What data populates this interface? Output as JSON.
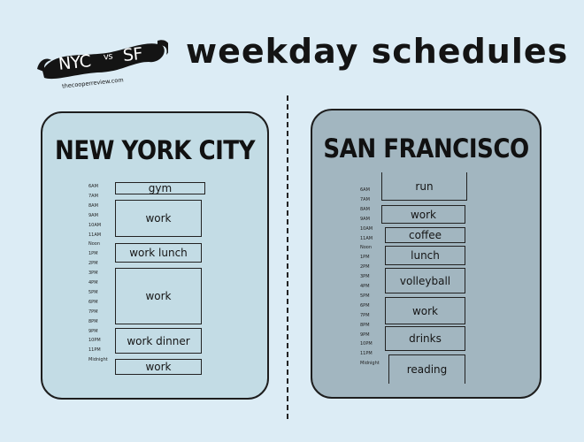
{
  "logo": {
    "nyc": "NYC",
    "vs": "vs",
    "sf": "SF",
    "url": "thecooperreview.com"
  },
  "title": "weekday schedules",
  "nyc": {
    "title": "NEW YORK CITY",
    "times": [
      "6AM",
      "7AM",
      "8AM",
      "9AM",
      "10AM",
      "11AM",
      "Noon",
      "1PM",
      "2PM",
      "3PM",
      "4PM",
      "5PM",
      "6PM",
      "7PM",
      "8PM",
      "9PM",
      "10PM",
      "11PM",
      "Midnight"
    ],
    "blocks": [
      {
        "label": "gym"
      },
      {
        "label": "work"
      },
      {
        "label": "work lunch"
      },
      {
        "label": "work"
      },
      {
        "label": "work dinner"
      },
      {
        "label": "work"
      }
    ]
  },
  "sf": {
    "title": "SAN FRANCISCO",
    "times": [
      "6AM",
      "7AM",
      "8AM",
      "9AM",
      "10AM",
      "11AM",
      "Noon",
      "1PM",
      "2PM",
      "3PM",
      "4PM",
      "5PM",
      "6PM",
      "7PM",
      "8PM",
      "9PM",
      "10PM",
      "11PM",
      "Midnight"
    ],
    "blocks": [
      {
        "label": "run"
      },
      {
        "label": "work"
      },
      {
        "label": "coffee"
      },
      {
        "label": "lunch"
      },
      {
        "label": "volleyball"
      },
      {
        "label": "work"
      },
      {
        "label": "drinks"
      },
      {
        "label": "reading"
      }
    ]
  }
}
